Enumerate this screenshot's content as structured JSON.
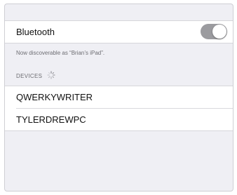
{
  "bluetooth": {
    "label": "Bluetooth",
    "toggle_state": "on",
    "status_text": "Now discoverable as “Brian’s iPad”."
  },
  "devices": {
    "header": "DEVICES",
    "items": [
      {
        "name": "QWERKYWRITER"
      },
      {
        "name": "TYLERDREWPC"
      }
    ]
  },
  "colors": {
    "background": "#efeff4",
    "cell": "#ffffff",
    "toggle": "#9b9b9f",
    "secondary_text": "#6d6d72"
  }
}
